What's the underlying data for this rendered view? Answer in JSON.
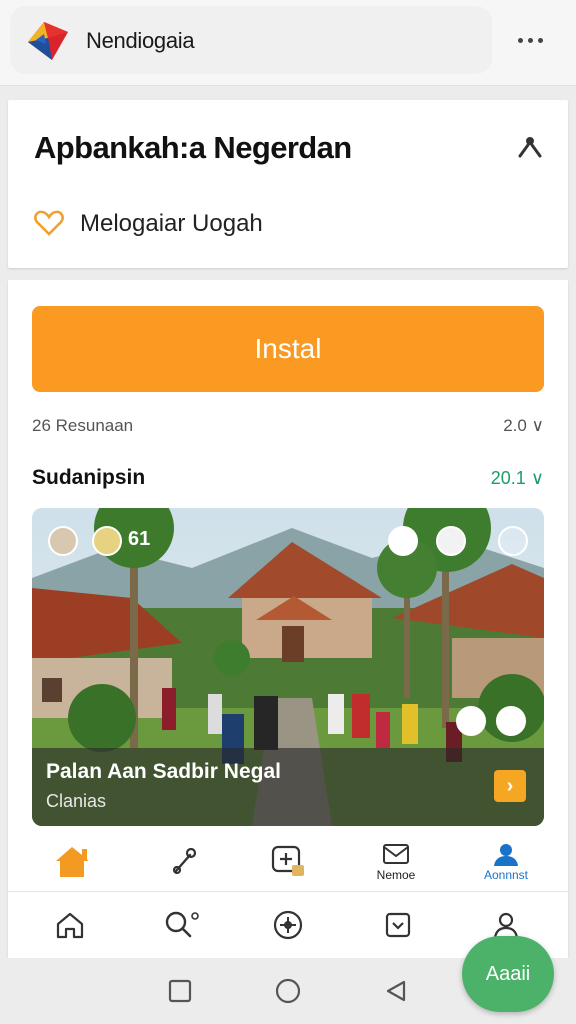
{
  "app": {
    "name": "Nendiogaia",
    "accent": "#fb9a22"
  },
  "header_card": {
    "title": "Apbankah:a Negerdan",
    "subtitle": "Melogaiar Uogah"
  },
  "install_button": {
    "label": "Instal"
  },
  "meta": {
    "left": "26 Resunaan",
    "right": "2.0"
  },
  "section": {
    "title": "Sudanipsin",
    "right": "20.1"
  },
  "photo": {
    "count": "61",
    "title": "Palan Aan Sadbir Negal",
    "subtitle": "Clanias"
  },
  "tabs": [
    {
      "icon": "home-icon",
      "label": "",
      "active": false
    },
    {
      "icon": "tools-icon",
      "label": "",
      "active": false
    },
    {
      "icon": "add-box-icon",
      "label": "",
      "active": false
    },
    {
      "icon": "mail-icon",
      "label": "Nemoe",
      "active": false
    },
    {
      "icon": "person-icon",
      "label": "Aonnnst",
      "active": true
    }
  ],
  "bottom_nav": [
    {
      "icon": "home-outline-icon"
    },
    {
      "icon": "search-icon"
    },
    {
      "icon": "compass-icon"
    },
    {
      "icon": "inbox-icon"
    },
    {
      "icon": "profile-icon"
    }
  ],
  "fab": {
    "label": "Aaaii"
  }
}
